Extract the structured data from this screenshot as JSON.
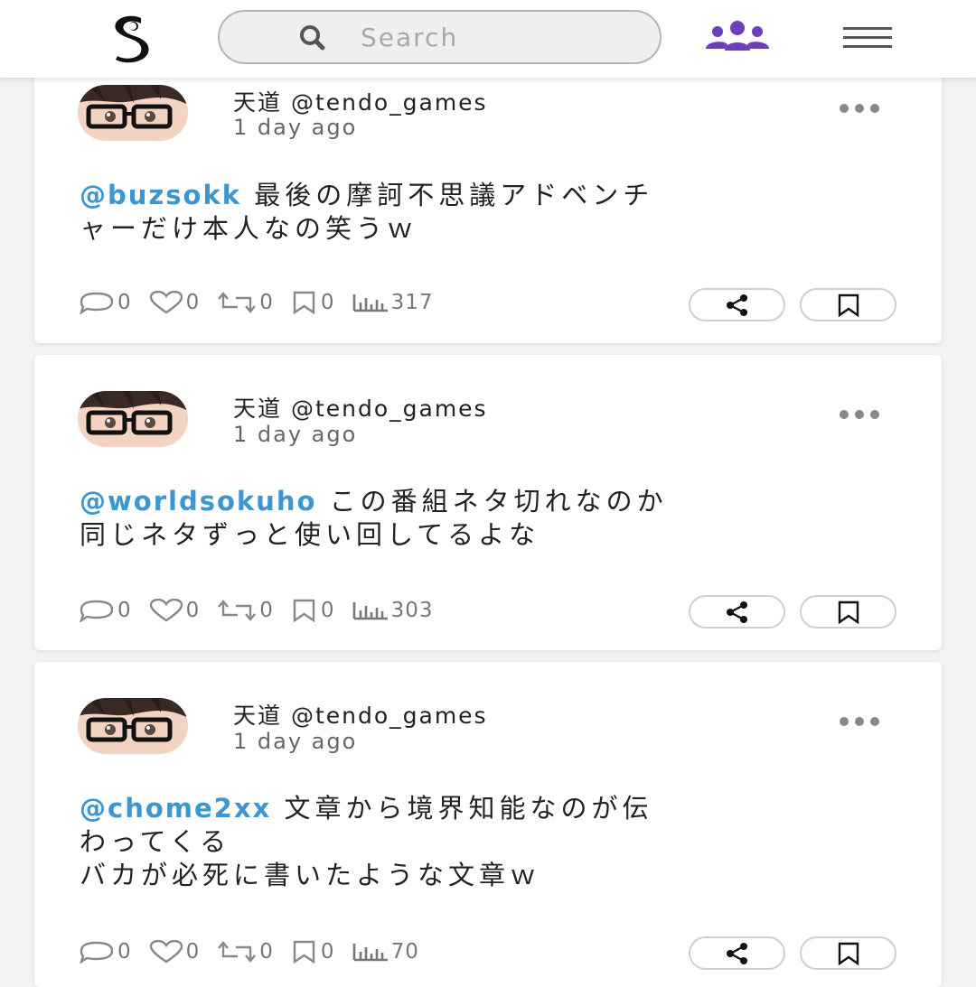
{
  "header": {
    "logo_text": "S",
    "search_placeholder": "Search"
  },
  "posts": [
    {
      "author": "天道 @tendo_games",
      "time": "1 day ago",
      "mention": "@buzsokk",
      "text_lines": [
        "最後の摩訶不思議アドベンチ",
        "ャーだけ本人なの笑うｗ"
      ],
      "replies": "0",
      "likes": "0",
      "reposts": "0",
      "bookmarks": "0",
      "views": "317"
    },
    {
      "author": "天道 @tendo_games",
      "time": "1 day ago",
      "mention": "@worldsokuho",
      "text_lines": [
        "この番組ネタ切れなのか",
        "同じネタずっと使い回してるよな"
      ],
      "replies": "0",
      "likes": "0",
      "reposts": "0",
      "bookmarks": "0",
      "views": "303"
    },
    {
      "author": "天道 @tendo_games",
      "time": "1 day ago",
      "mention": "@chome2xx",
      "text_lines": [
        "文章から境界知能なのが伝",
        "わってくる",
        "バカが必死に書いたような文章ｗ"
      ],
      "replies": "0",
      "likes": "0",
      "reposts": "0",
      "bookmarks": "0",
      "views": "70"
    }
  ],
  "icons": {
    "logo": "s-logo-icon",
    "search": "search-icon",
    "group": "users-group-icon",
    "menu": "hamburger-menu-icon",
    "more": "more-dots-icon",
    "reply": "comment-icon",
    "like": "heart-icon",
    "repost": "repost-icon",
    "bookmark": "bookmark-icon",
    "views": "bar-chart-icon",
    "share": "share-icon"
  },
  "colors": {
    "mention": "#3b96d2",
    "group_icon": "#6b3fc0",
    "text": "#222222",
    "meta": "#777777"
  }
}
